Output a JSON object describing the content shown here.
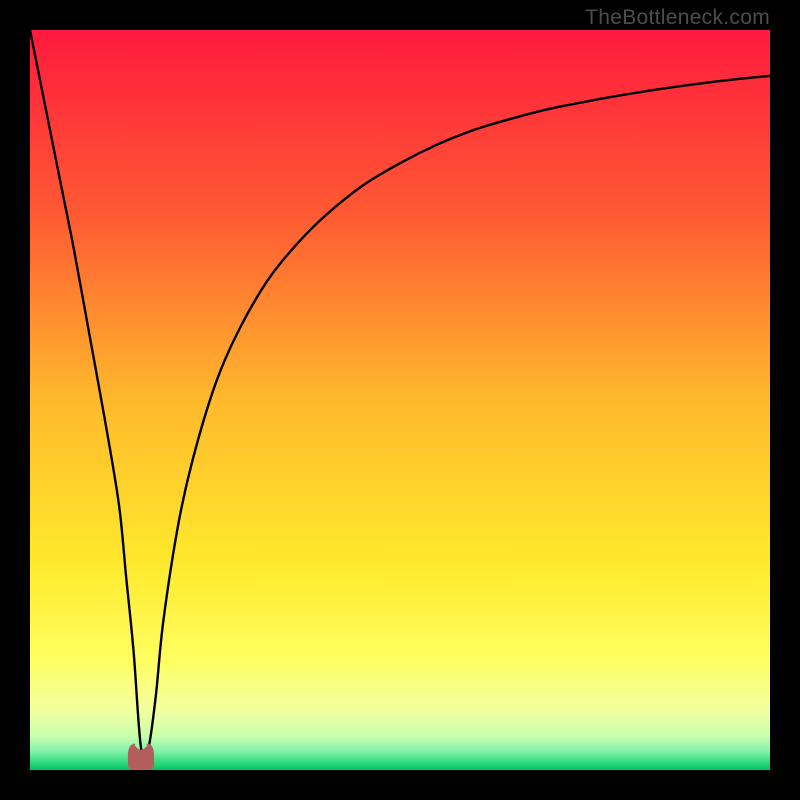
{
  "watermark": {
    "text": "TheBottleneck.com"
  },
  "colors": {
    "frame": "#000000",
    "watermark": "#4d4d4d",
    "curve": "#000000",
    "marker_fill": "#b35e5c",
    "marker_stroke": "#b35e5c",
    "gradient_stops": [
      {
        "offset": 0.0,
        "color": "#ff1a3e"
      },
      {
        "offset": 0.25,
        "color": "#ff5a33"
      },
      {
        "offset": 0.5,
        "color": "#ffb92c"
      },
      {
        "offset": 0.72,
        "color": "#ffe92c"
      },
      {
        "offset": 0.85,
        "color": "#ffff60"
      },
      {
        "offset": 0.92,
        "color": "#f2ffa0"
      },
      {
        "offset": 0.955,
        "color": "#c6ffad"
      },
      {
        "offset": 0.975,
        "color": "#80f2a8"
      },
      {
        "offset": 0.99,
        "color": "#2fd97e"
      },
      {
        "offset": 1.0,
        "color": "#00c26a"
      }
    ]
  },
  "chart_data": {
    "type": "line",
    "title": "",
    "xlabel": "",
    "ylabel": "",
    "xlim": [
      0,
      100
    ],
    "ylim": [
      0,
      100
    ],
    "series": [
      {
        "name": "bottleneck-curve",
        "x": [
          0,
          2,
          4,
          6,
          8,
          10,
          12,
          13,
          14,
          15,
          16,
          17,
          18,
          20,
          22,
          25,
          28,
          32,
          36,
          40,
          45,
          50,
          55,
          60,
          65,
          70,
          75,
          80,
          85,
          90,
          95,
          100
        ],
        "values": [
          100,
          90,
          80,
          70,
          59,
          48,
          36,
          26,
          16,
          3,
          3,
          10,
          20,
          33,
          42,
          52,
          59,
          66,
          71,
          75,
          79,
          82,
          84.5,
          86.5,
          88,
          89.3,
          90.3,
          91.2,
          92,
          92.7,
          93.3,
          93.8
        ]
      }
    ],
    "marker": {
      "x": 15,
      "y": 1.5,
      "width": 3.4,
      "height": 3.6
    },
    "grid": false,
    "legend": false
  }
}
